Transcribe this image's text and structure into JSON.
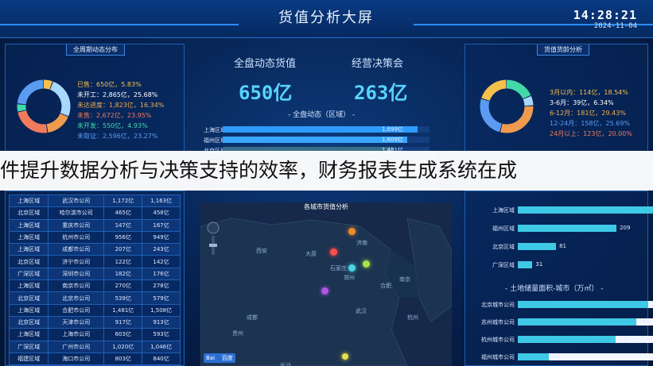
{
  "header": {
    "title": "货值分析大屏",
    "time": "14:28:21",
    "date": "2024-11-04"
  },
  "left_top": {
    "tag": "全周期动态分布",
    "items": [
      {
        "label": "已售：650亿，5.83%",
        "color": "#f6c04c",
        "fraction": 0.0583
      },
      {
        "label": "未开工：2,865亿，25.68%",
        "color": "#ffffff",
        "fraction": 0.2568
      },
      {
        "label": "未达进度：1,823亿，16.34%",
        "color": "#f5b04a",
        "fraction": 0.1634
      },
      {
        "label": "未售：2,672亿，23.95%",
        "color": "#f07b5c",
        "fraction": 0.2395
      },
      {
        "label": "未开发：550亿，4.93%",
        "color": "#42d9a8",
        "fraction": 0.0493
      },
      {
        "label": "未取证：2,596亿，23.27%",
        "color": "#5b9cf2",
        "fraction": 0.2327
      }
    ],
    "ring_colors": [
      "#f6c04c",
      "#a9d8ff",
      "#f09a4e",
      "#f07b5c",
      "#42d9a8",
      "#5b9cf2"
    ]
  },
  "center_top": {
    "kpi_dynamic_label": "全盘动态货值",
    "kpi_dynamic_value": "650亿",
    "kpi_decision_label": "经营决策会",
    "kpi_decision_value": "263亿",
    "sub_title": "- 全盘动态（区域） -",
    "bars": [
      {
        "label": "上海区域",
        "value": 1699,
        "text": "1,699亿"
      },
      {
        "label": "福州区域",
        "value": 1609,
        "text": "1,609亿"
      },
      {
        "label": "北京区域",
        "value": 1481,
        "text": "1,481亿"
      }
    ],
    "bar_max": 1800
  },
  "right_top": {
    "tag": "货值货龄分析",
    "items": [
      {
        "label": "3月以内：114亿，18.54%",
        "color": "#f6c04c",
        "fraction": 0.1854
      },
      {
        "label": "3-6月：39亿，6.34%",
        "color": "#ffffff",
        "fraction": 0.0634
      },
      {
        "label": "6-12月：181亿，29.43%",
        "color": "#f5b04a",
        "fraction": 0.2943
      },
      {
        "label": "12-24月：158亿，25.69%",
        "color": "#5b9cf2",
        "fraction": 0.2569
      },
      {
        "label": "24月以上：123亿，20.00%",
        "color": "#f07b5c",
        "fraction": 0.2
      }
    ],
    "ring_colors": [
      "#42d9a8",
      "#a9d8ff",
      "#f09a4e",
      "#5b9cf2",
      "#f6c04c"
    ]
  },
  "banner": {
    "text": "件提升数据分析与决策支持的效率，财务报表生成系统在成"
  },
  "left_table": {
    "rows": [
      [
        "上海区域",
        "武汉市公司",
        "1,172亿",
        "1,163亿"
      ],
      [
        "北京区域",
        "哈尔滨市公司",
        "465亿",
        "458亿"
      ],
      [
        "上海区域",
        "重庆市公司",
        "147亿",
        "167亿"
      ],
      [
        "上海区域",
        "杭州市公司",
        "956亿",
        "949亿"
      ],
      [
        "上海区域",
        "成都市公司",
        "207亿",
        "243亿"
      ],
      [
        "北京区域",
        "济宁市公司",
        "122亿",
        "142亿"
      ],
      [
        "广深区域",
        "深圳市公司",
        "182亿",
        "176亿"
      ],
      [
        "上海区域",
        "南京市公司",
        "270亿",
        "278亿"
      ],
      [
        "北京区域",
        "北京市公司",
        "539亿",
        "579亿"
      ],
      [
        "上海区域",
        "合肥市公司",
        "1,481亿",
        "1,508亿"
      ],
      [
        "北京区域",
        "天津市公司",
        "917亿",
        "913亿"
      ],
      [
        "上海区域",
        "上海市公司",
        "603亿",
        "593亿"
      ],
      [
        "广深区域",
        "广州市公司",
        "1,020亿",
        "1,046亿"
      ],
      [
        "福建区域",
        "海口市公司",
        "803亿",
        "840亿"
      ]
    ]
  },
  "map": {
    "title": "各城市货值分析",
    "cities": [
      "大原",
      "济南",
      "石家庄",
      "郑州",
      "南京",
      "合肥",
      "武汉",
      "成都",
      "西安",
      "长沙",
      "贵州",
      "杭州"
    ],
    "logo_text": "Bai🐾百度"
  },
  "right_bottom": {
    "region_bars": [
      {
        "label": "上海区域",
        "value": 299
      },
      {
        "label": "福州区域",
        "value": 209
      },
      {
        "label": "北京区域",
        "value": 81
      },
      {
        "label": "广深区域",
        "value": 31
      }
    ],
    "land_title": "- 土地储量面积-城市（万㎡） -",
    "city_bars": [
      {
        "label": "北京城市公司",
        "value": 182
      },
      {
        "label": "苏州城市公司",
        "value": 165
      },
      {
        "label": "杭州城市公司",
        "value": 137
      },
      {
        "label": "福州城市公司",
        "value": 43
      }
    ]
  }
}
